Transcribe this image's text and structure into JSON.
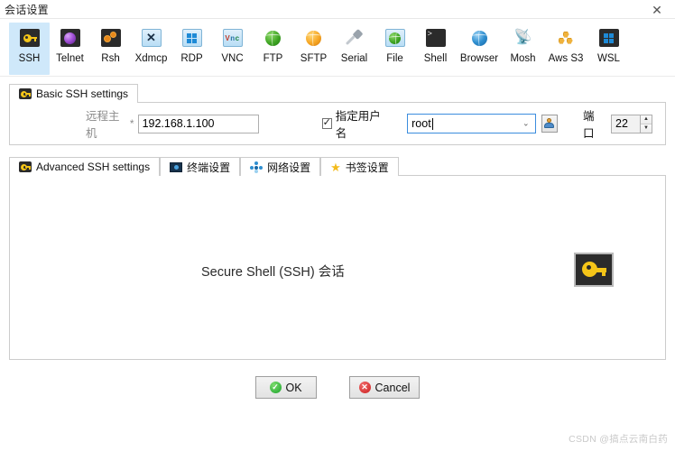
{
  "window": {
    "title": "会话设置",
    "close_label": "✕"
  },
  "protocols": {
    "selected": "SSH",
    "items": [
      {
        "label": "SSH",
        "icon": "ssh-key-icon"
      },
      {
        "label": "Telnet",
        "icon": "telnet-sphere-icon"
      },
      {
        "label": "Rsh",
        "icon": "rsh-gears-icon"
      },
      {
        "label": "Xdmcp",
        "icon": "xdmcp-monitor-icon"
      },
      {
        "label": "RDP",
        "icon": "rdp-windows-monitor-icon"
      },
      {
        "label": "VNC",
        "icon": "vnc-monitor-icon"
      },
      {
        "label": "FTP",
        "icon": "ftp-globe-icon"
      },
      {
        "label": "SFTP",
        "icon": "sftp-globe-icon"
      },
      {
        "label": "Serial",
        "icon": "serial-plug-icon"
      },
      {
        "label": "File",
        "icon": "file-monitor-globe-icon"
      },
      {
        "label": "Shell",
        "icon": "shell-terminal-icon"
      },
      {
        "label": "Browser",
        "icon": "browser-globe-icon"
      },
      {
        "label": "Mosh",
        "icon": "mosh-satellite-icon"
      },
      {
        "label": "Aws S3",
        "icon": "aws-s3-buckets-icon"
      },
      {
        "label": "WSL",
        "icon": "wsl-windows-icon"
      }
    ]
  },
  "basic": {
    "tab_label": "Basic SSH settings",
    "tab_icon": "key-icon",
    "host_label": "远程主机",
    "host_required_mark": "*",
    "host_value": "192.168.1.100",
    "host_placeholder": "",
    "username_checkbox_label": "指定用户名",
    "username_checked": true,
    "username_value": "root",
    "username_placeholder": "",
    "user_browse_icon": "person-icon",
    "port_label": "端口",
    "port_value": "22",
    "spinner_up": "▲",
    "spinner_down": "▼",
    "combo_arrow": "⌄"
  },
  "advanced": {
    "tabs": [
      {
        "label": "Advanced SSH settings",
        "icon": "key-icon",
        "active": true
      },
      {
        "label": "终端设置",
        "icon": "terminal-icon",
        "active": false
      },
      {
        "label": "网络设置",
        "icon": "network-icon",
        "active": false
      },
      {
        "label": "书签设置",
        "icon": "star-icon",
        "active": false
      }
    ],
    "description": "Secure Shell (SSH) 会话",
    "description_icon": "key-icon"
  },
  "footer": {
    "ok_label": "OK",
    "ok_icon": "check-circle-icon",
    "cancel_label": "Cancel",
    "cancel_icon": "x-circle-icon"
  },
  "watermark": "CSDN @搞点云南白药",
  "colors": {
    "selection": "#cfe8fa",
    "focus_border": "#3c8dde",
    "key_yellow": "#f5c518",
    "ok_green": "#19a32a",
    "cancel_red": "#cc2020",
    "label_grey": "#8c8c8c"
  }
}
